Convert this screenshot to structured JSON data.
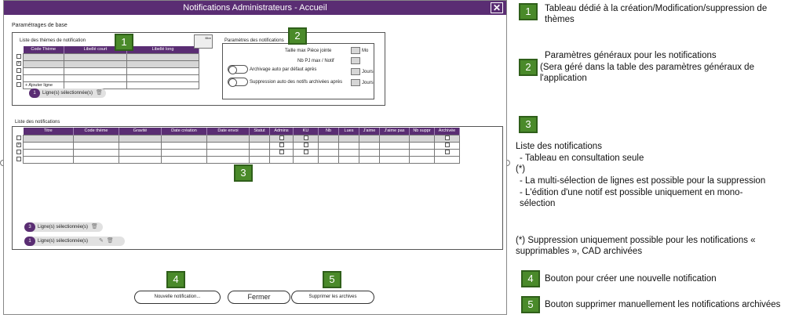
{
  "window": {
    "title": "Notifications Administrateurs - Accueil",
    "close_glyph": "✕"
  },
  "base_params": {
    "legend": "Paramétrages de base",
    "themes": {
      "title": "Liste des thèmes de notification",
      "columns": [
        "Code Thème",
        "Libellé court",
        "Libellé long"
      ],
      "add_row": "+ Ajouter ligne",
      "filter_label": "filtre",
      "selection_count": "1",
      "selection_text": "Ligne(s) sélectionnée(s)"
    },
    "notif_params": {
      "title": "Paramètres des notifications",
      "max_attachment": "Taille max Pièce jointe",
      "max_attachment_unit": "Mo",
      "max_attachments_per_notif": "Nb PJ max / Notif",
      "auto_archive": "Archivage auto par défaut après",
      "auto_archive_unit": "Jours",
      "auto_delete": "Suppression auto des notifs archivées après",
      "auto_delete_unit": "Jours"
    }
  },
  "notifications": {
    "title": "Liste des  notifications",
    "columns": [
      "Titre",
      "Code thème",
      "Gravité",
      "Date création",
      "Date envoi",
      "Statut",
      "Admins",
      "KU",
      "Nb",
      "Lues",
      "J'aime",
      "J'aime pas",
      "Nb suppr",
      "Archivée"
    ],
    "selection_multi_count": "3",
    "selection_multi_text": "Ligne(s) sélectionnée(s)",
    "selection_single_count": "1",
    "selection_single_text": "Ligne(s) sélectionnée(s)"
  },
  "buttons": {
    "new_notification": "Nouvelle notification...",
    "close": "Fermer",
    "delete_archives": "Supprimer les archives"
  },
  "callouts": [
    "1",
    "2",
    "3",
    "4",
    "5"
  ],
  "notes": {
    "n1": "Tableau dédié à la création/Modification/suppression de thèmes",
    "n2_line1": "Paramètres généraux pour les notifications",
    "n2_line2": "(Sera géré dans la table des paramètres généraux de l'application",
    "n3_title": "Liste des notifications",
    "n3_line1": "- Tableau en consultation seule",
    "n3_star": "(*)",
    "n3_line2": "- La multi-sélection de lignes est possible pour la suppression",
    "n3_line3": "- L'édition d'une notif est possible uniquement en mono-sélection",
    "n3_footnote": "(*) Suppression uniquement possible pour les notifications « supprimables », CAD archivées",
    "n4": "Bouton pour créer une nouvelle notification",
    "n5": "Bouton supprimer manuellement les notifications archivées"
  },
  "colors": {
    "accent": "#5a2d73",
    "callout": "#4a8a2a"
  },
  "icons": {
    "close": "close-icon",
    "trash": "trash-icon",
    "edit": "edit-icon",
    "menu": "dots-icon"
  }
}
